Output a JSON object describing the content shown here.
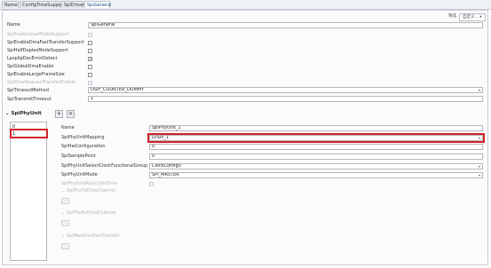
{
  "tabs": [
    "Name",
    "ConfigTimeSupport",
    "SpiDriver",
    "SpiGeneral"
  ],
  "topright": {
    "label": "筛选",
    "dropdown": "自定义..."
  },
  "general": {
    "name_label": "Name",
    "name_value": "SpiGeneral",
    "rows": [
      {
        "label": "SpiEnableUserModeSupport"
      },
      {
        "label": "SpiEnableDmaFastTransferSupport"
      },
      {
        "label": "SpiHalfDuplexModeSupport"
      },
      {
        "label": "LpspiIpDevErrorDetect",
        "check": "✓"
      },
      {
        "label": "SpiGlobalDmaEnable"
      },
      {
        "label": "SpiEnableLargeFrameSize"
      },
      {
        "label": "SpiDmaRequestTransferEnable"
      }
    ],
    "timeout_method_label": "SpiTimeoutMethod",
    "timeout_method_value": "OSIF_COUNTER_DUMMY",
    "transmit_timeout_label": "SpiTransmitTimeout",
    "transmit_timeout_value": "1"
  },
  "phyunit": {
    "section_title": "SpiPhyUnit",
    "add_label": "+",
    "remove_label": "×",
    "list": [
      "0",
      "1"
    ],
    "name_label": "Name",
    "name_value": "SpiPhyUnit_1",
    "mapping_label": "SpiPhyUnitMapping",
    "mapping_value": "LPSPI_1",
    "hw_config_label": "SpiHwConfiguration",
    "hw_config_value": "0",
    "sample_point_label": "SpiSamplePoint",
    "sample_point_value": "0",
    "clock_group_label": "SpiPhyUnitSelectClockFunctionalGroup",
    "clock_group_value": "ClockConfig0",
    "mode_label": "SpiPhyUnitMode",
    "mode_value": "SPI_MASTER",
    "async_dma_label": "SpiPhyUnitAsyncUseDma",
    "tx_dma_label": "SpiPhyTxDmaChannel",
    "rx_dma_label": "SpiPhyRxDmaChannel",
    "fast_transfer_label": "SpiMaxDmaFastTransfer"
  }
}
